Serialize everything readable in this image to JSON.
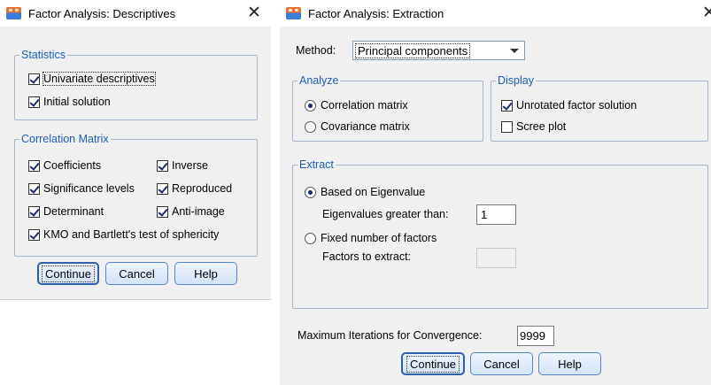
{
  "descriptives": {
    "title": "Factor Analysis: Descriptives",
    "close_glyph": "✕",
    "statistics": {
      "legend": "Statistics",
      "items": [
        {
          "label": "Univariate descriptives",
          "checked": true
        },
        {
          "label": "Initial solution",
          "checked": true
        }
      ]
    },
    "correlation_matrix": {
      "legend": "Correlation Matrix",
      "items": [
        {
          "label": "Coefficients",
          "checked": true
        },
        {
          "label": "Inverse",
          "checked": true
        },
        {
          "label": "Significance levels",
          "checked": true
        },
        {
          "label": "Reproduced",
          "checked": true
        },
        {
          "label": "Determinant",
          "checked": true
        },
        {
          "label": "Anti-image",
          "checked": true
        },
        {
          "label": "KMO and Bartlett's test of sphericity",
          "checked": true
        }
      ]
    },
    "buttons": {
      "continue": "Continue",
      "cancel": "Cancel",
      "help": "Help"
    }
  },
  "extraction": {
    "title": "Factor Analysis: Extraction",
    "close_glyph": "✕",
    "method_label": "Method:",
    "method_value": "Principal components",
    "analyze": {
      "legend": "Analyze",
      "options": [
        {
          "label": "Correlation matrix",
          "selected": true
        },
        {
          "label": "Covariance matrix",
          "selected": false
        }
      ]
    },
    "display": {
      "legend": "Display",
      "items": [
        {
          "label": "Unrotated factor solution",
          "checked": true
        },
        {
          "label": "Scree plot",
          "checked": false
        }
      ]
    },
    "extract": {
      "legend": "Extract",
      "based_on_eigenvalue": "Based on Eigenvalue",
      "eigen_label": "Eigenvalues greater than:",
      "eigen_value": "1",
      "fixed_number": "Fixed number of factors",
      "factors_label": "Factors to extract:",
      "factors_value": "",
      "selected": "eigenvalue"
    },
    "max_iter_label": "Maximum Iterations for Convergence:",
    "max_iter_value": "9999",
    "buttons": {
      "continue": "Continue",
      "cancel": "Cancel",
      "help": "Help"
    }
  }
}
